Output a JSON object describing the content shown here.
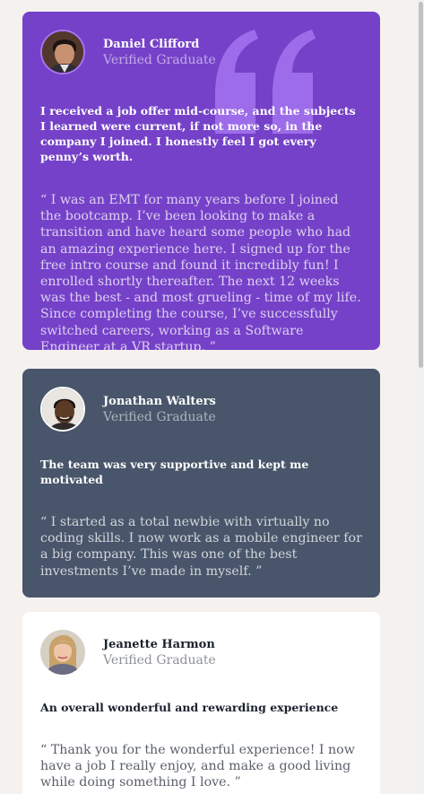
{
  "testimonials": [
    {
      "name": "Daniel Clifford",
      "role": "Verified Graduate",
      "headline": "I received a job offer mid-course, and the subjects I learned were current, if not more so, in the company I joined. I honestly feel I got every penny’s worth.",
      "body": "“ I was an EMT for many years before I joined the bootcamp. I’ve been looking to make a transition and have heard some people who had an amazing experience here. I signed up for the free intro course and found it incredibly fun! I enrolled shortly thereafter. The next 12 weeks was the best - and most grueling - time of my life. Since completing the course, I’ve successfully switched careers, working as a Software Engineer at a VR startup. ”"
    },
    {
      "name": "Jonathan Walters",
      "role": "Verified Graduate",
      "headline": "The team was very supportive and kept me motivated",
      "body": "“ I started as a total newbie with virtually no coding skills. I now work as a mobile engineer for a big company. This was one of the best investments I’ve made in myself. ”"
    },
    {
      "name": "Jeanette Harmon",
      "role": "Verified Graduate",
      "headline": "An overall wonderful and rewarding experience",
      "body": "“ Thank you for the wonderful experience! I now have a job I really enjoy, and make a good living while doing something I love. ”"
    }
  ],
  "colors": {
    "background": "#f4f1ef",
    "card_purple": "#7541c8",
    "card_slate": "#48556a",
    "card_white": "#ffffff",
    "quote_mark": "#9d6cea"
  },
  "icons": [
    "quotation-mark-icon"
  ]
}
